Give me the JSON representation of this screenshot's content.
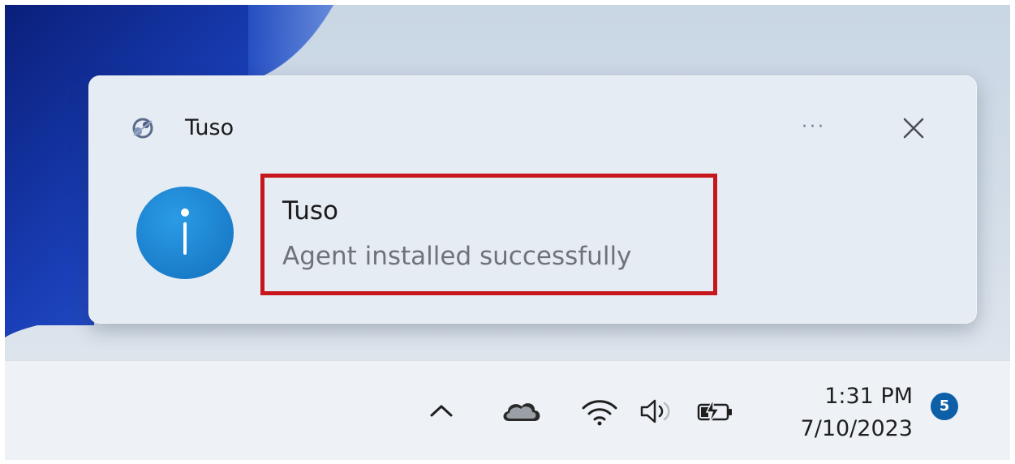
{
  "toast": {
    "app_name": "Tuso",
    "more_label": "···",
    "title": "Tuso",
    "message": "Agent installed successfully",
    "badge_icon": "info-icon",
    "close_icon": "close-icon"
  },
  "tray": {
    "icons": [
      "chevron-up-icon",
      "onedrive-cloud-icon",
      "wifi-icon",
      "volume-icon",
      "battery-charging-icon"
    ]
  },
  "clock": {
    "time": "1:31 PM",
    "date": "7/10/2023"
  },
  "notifications": {
    "count": "5"
  },
  "colors": {
    "accent": "#1a8ad8",
    "highlight": "#c8161d",
    "badge": "#0d5fa8",
    "wallpaper_dark": "#0a2a8c"
  }
}
